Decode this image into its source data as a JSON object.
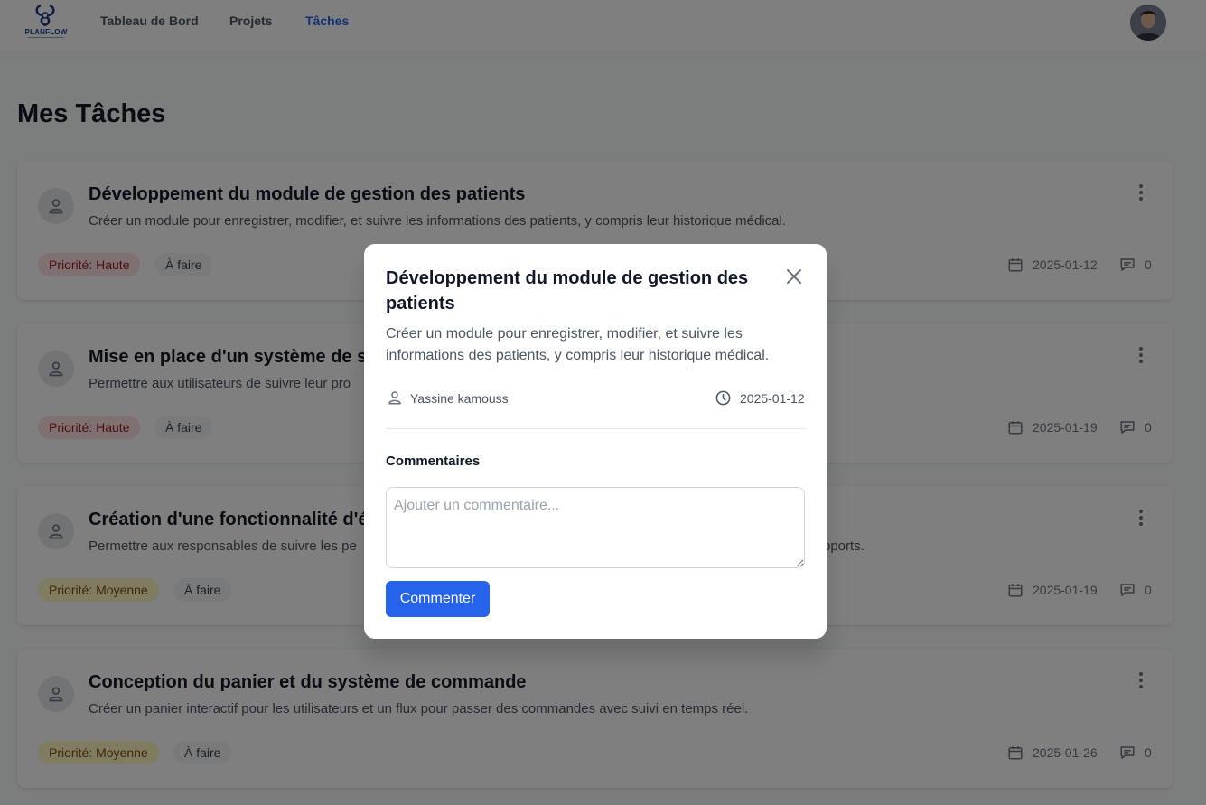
{
  "app": {
    "logo_text": "PLANFLOW",
    "brand_color": "#1e3a8a",
    "accent_color": "#2563eb"
  },
  "nav": {
    "items": [
      {
        "label": "Tableau de Bord",
        "active": false
      },
      {
        "label": "Projets",
        "active": false
      },
      {
        "label": "Tâches",
        "active": true
      }
    ],
    "avatar_icon": "user-avatar-photo"
  },
  "page": {
    "title": "Mes Tâches"
  },
  "tasks": [
    {
      "title": "Développement du module de gestion des patients",
      "description": "Créer un module pour enregistrer, modifier, et suivre les informations des patients, y compris leur historique médical.",
      "priority": "Priorité: Haute",
      "priority_level": "high",
      "status": "À faire",
      "due_date": "2025-01-12",
      "comments": "0"
    },
    {
      "title": "Mise en place d'un système de su",
      "description": "Permettre aux utilisateurs de suivre leur pro",
      "priority": "Priorité: Haute",
      "priority_level": "high",
      "status": "À faire",
      "due_date": "2025-01-19",
      "comments": "0"
    },
    {
      "title": "Création d'une fonctionnalité d'év",
      "description": "Permettre aux responsables de suivre les pe",
      "description_end": "pports.",
      "priority": "Priorité: Moyenne",
      "priority_level": "medium",
      "status": "À faire",
      "due_date": "2025-01-19",
      "comments": "0"
    },
    {
      "title": "Conception du panier et du système de commande",
      "description": "Créer un panier interactif pour les utilisateurs et un flux pour passer des commandes avec suivi en temps réel.",
      "priority": "Priorité: Moyenne",
      "priority_level": "medium",
      "status": "À faire",
      "due_date": "2025-01-26",
      "comments": "0"
    }
  ],
  "modal": {
    "title": "Développement du module de gestion des patients",
    "description": "Créer un module pour enregistrer, modifier, et suivre les informations des patients, y compris leur historique médical.",
    "assignee": "Yassine kamouss",
    "date": "2025-01-12",
    "comments_heading": "Commentaires",
    "comment_placeholder": "Ajouter un commentaire...",
    "comment_value": "",
    "submit_label": "Commenter",
    "icons": {
      "close": "close-icon",
      "assignee": "user-icon",
      "date": "clock-icon"
    }
  }
}
